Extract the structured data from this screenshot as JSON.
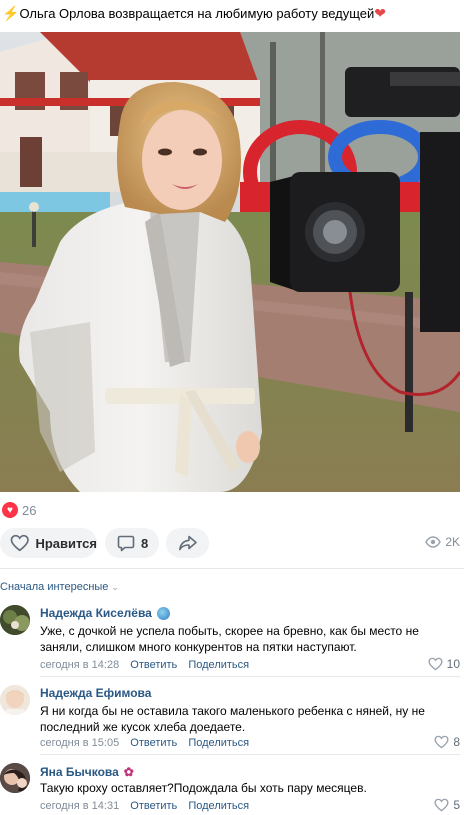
{
  "post": {
    "title_emoji_left": "⚡",
    "title": "Ольга Орлова возвращается на любимую работу ведущей",
    "title_emoji_right": "❤",
    "reactions_count": "26",
    "actions": {
      "like_label": "Нравится",
      "comments_count": "8",
      "views": "2K"
    }
  },
  "comments_header": {
    "sort_label": "Сначала интересные"
  },
  "comments": [
    {
      "author": "Надежда Киселёва",
      "text": "Уже, с дочкой не успела побыть, скорее на бревно, как бы место не заняли, слишком много конкурентов на пятки наступают.",
      "time": "сегодня в 14:28",
      "reply_label": "Ответить",
      "share_label": "Поделиться",
      "likes": "10"
    },
    {
      "author": "Надежда Ефимова",
      "text": "Я ни когда бы не оставила такого маленького ребенка с няней, ну не последний же кусок хлеба доедаете.",
      "time": "сегодня в 15:05",
      "reply_label": "Ответить",
      "share_label": "Поделиться",
      "likes": "8"
    },
    {
      "author": "Яна Бычкова",
      "text": "Такую кроху оставляет?Подождала бы хоть пару месяцев.",
      "time": "сегодня в 14:31",
      "reply_label": "Ответить",
      "share_label": "Поделиться",
      "likes": "5"
    }
  ],
  "colors": {
    "link": "#2a5885",
    "secondary_text": "#818c99",
    "pill_bg": "#f2f3f5",
    "reaction_heart": "#ff3347"
  },
  "icons": [
    "lightning-icon",
    "heart-emoji-icon",
    "reaction-heart-icon",
    "like-heart-icon",
    "comment-icon",
    "share-icon",
    "eye-icon",
    "chevron-down-icon",
    "globe-badge-icon",
    "paw-badge-icon"
  ]
}
